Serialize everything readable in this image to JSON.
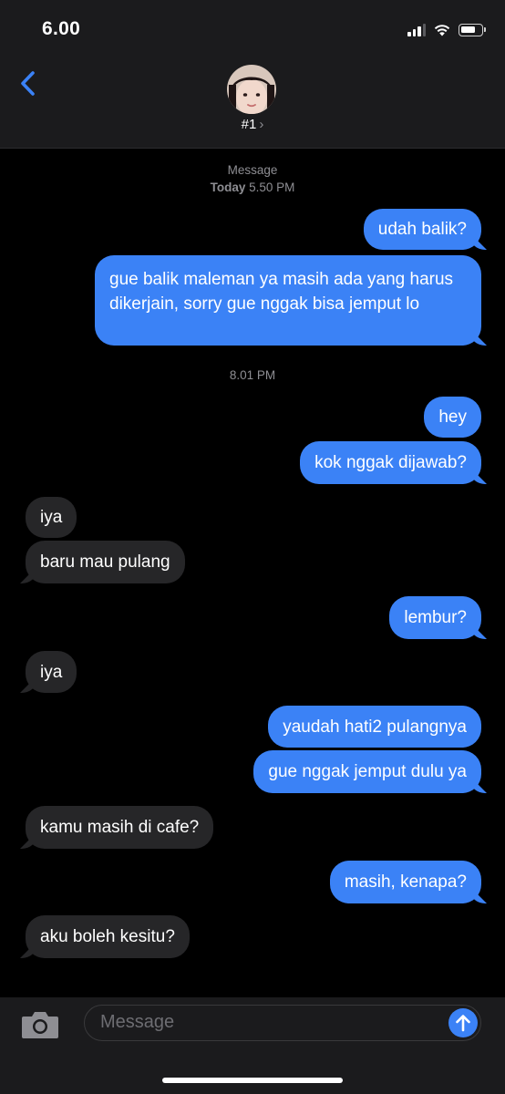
{
  "status_bar": {
    "time": "6.00",
    "icons": [
      "cellular-signal-icon",
      "wifi-icon",
      "battery-icon"
    ]
  },
  "nav": {
    "back_icon": "chevron-left-icon",
    "contact_name": "#1",
    "contact_chevron": "›"
  },
  "thread": {
    "header_service": "Message",
    "header_day": "Today",
    "header_time": "5.50 PM",
    "separator_time": "8.01 PM",
    "messages": [
      {
        "dir": "out",
        "text": "udah balik?"
      },
      {
        "dir": "out",
        "text": "gue balik maleman ya masih ada yang harus dikerjain, sorry gue nggak bisa jemput lo"
      },
      {
        "dir": "out",
        "text": "hey"
      },
      {
        "dir": "out",
        "text": "kok nggak dijawab?"
      },
      {
        "dir": "in",
        "text": "iya"
      },
      {
        "dir": "in",
        "text": "baru mau pulang"
      },
      {
        "dir": "out",
        "text": "lembur?"
      },
      {
        "dir": "in",
        "text": "iya"
      },
      {
        "dir": "out",
        "text": "yaudah hati2 pulangnya"
      },
      {
        "dir": "out",
        "text": "gue nggak jemput dulu ya"
      },
      {
        "dir": "in",
        "text": "kamu masih di cafe?"
      },
      {
        "dir": "out",
        "text": "masih, kenapa?"
      },
      {
        "dir": "in",
        "text": "aku boleh kesitu?"
      }
    ]
  },
  "composer": {
    "placeholder": "Message",
    "camera_icon": "camera-icon",
    "send_icon": "arrow-up-icon"
  },
  "colors": {
    "outgoing": "#3b82f6",
    "incoming": "#262628",
    "background": "#000000",
    "bar": "#1b1b1d"
  }
}
